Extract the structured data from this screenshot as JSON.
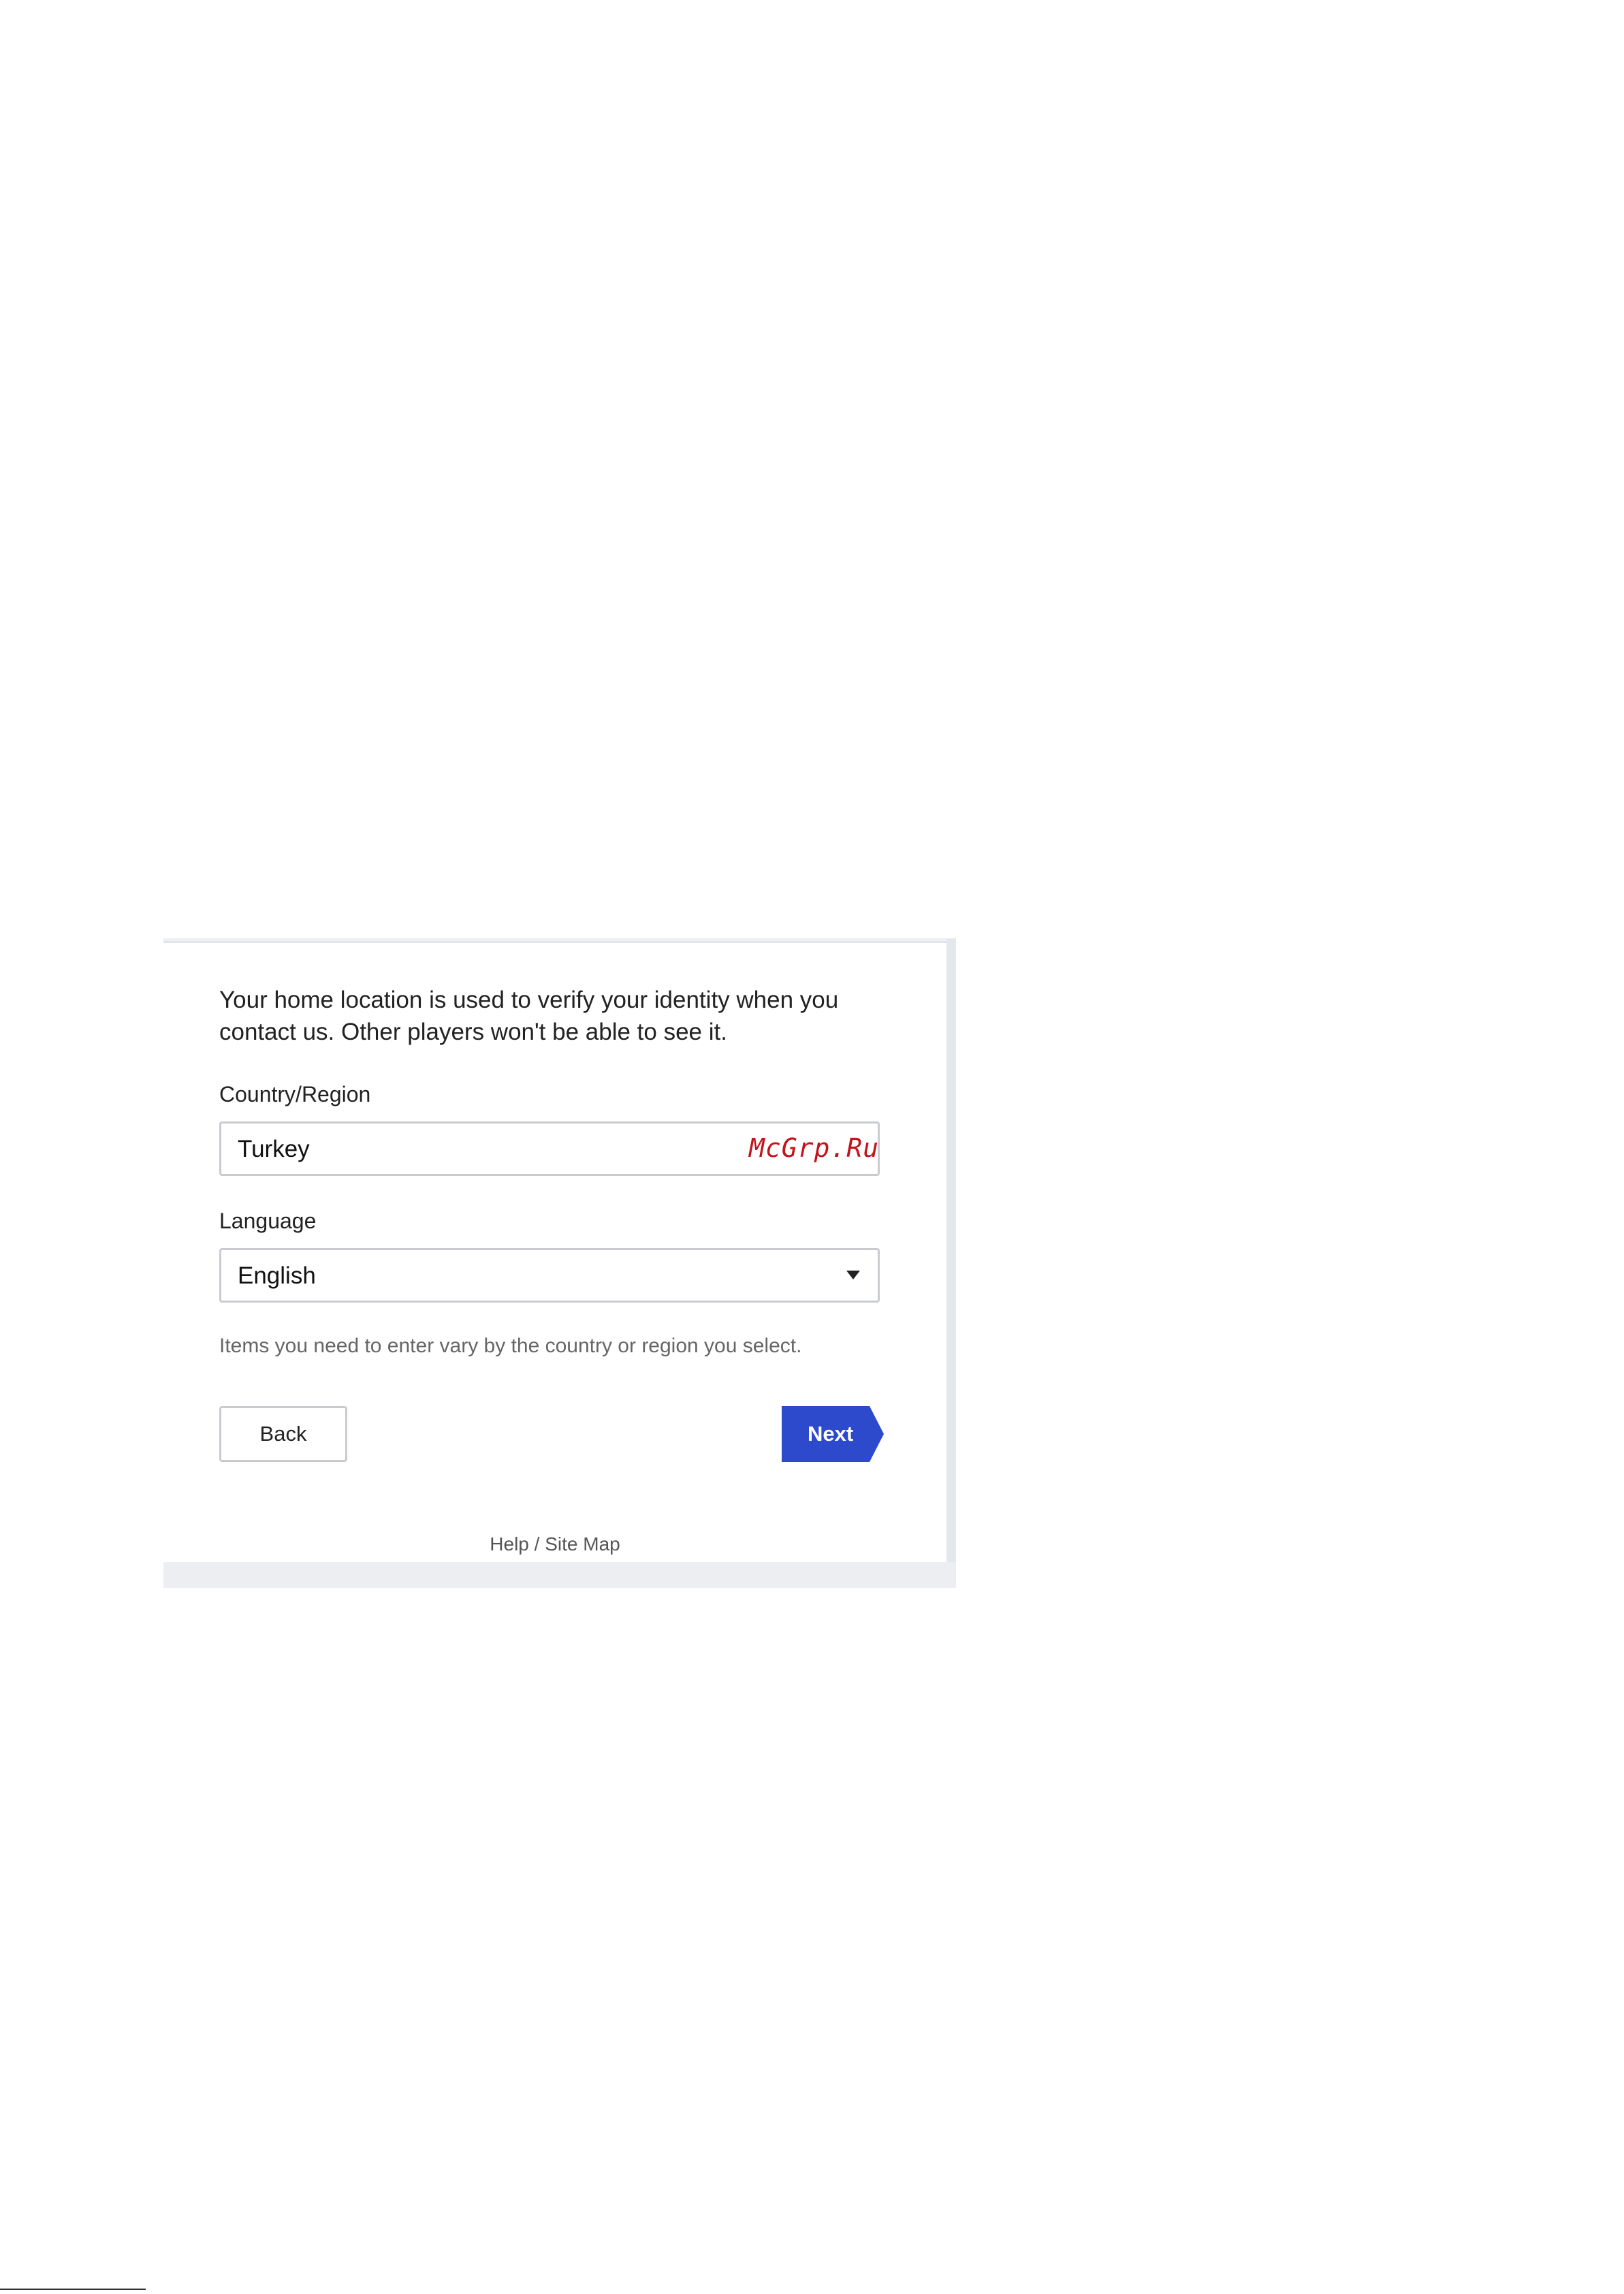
{
  "intro_text": "Your home location is used to verify your identity when you contact us. Other players won't be able to see it.",
  "country": {
    "label": "Country/Region",
    "value": "Turkey"
  },
  "language": {
    "label": "Language",
    "value": "English"
  },
  "watermark": "McGrp.Ru",
  "hint": "Items you need to enter vary by the country or region you select.",
  "buttons": {
    "back": "Back",
    "next": "Next"
  },
  "footer": {
    "help": "Help",
    "separator": " / ",
    "site_map": "Site Map"
  },
  "colors": {
    "next_button": "#2d49cc",
    "watermark": "#c4141b",
    "field_border": "#c9cbd0",
    "hint_text": "#666666"
  },
  "icons": {
    "language_dropdown": "caret-down-icon"
  }
}
